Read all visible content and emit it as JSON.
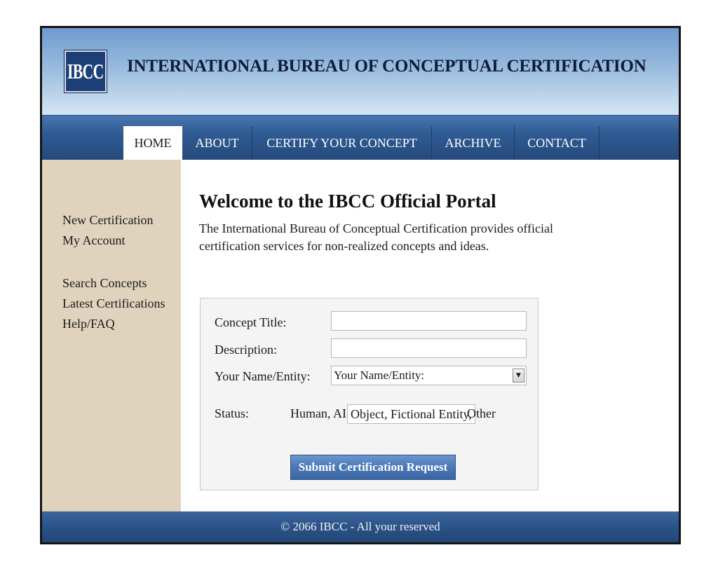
{
  "header": {
    "logo_text": "IBCC",
    "title": "INTERNATIONAL BUREAU OF CONCEPTUAL CERTIFICATION"
  },
  "nav": {
    "tabs": [
      {
        "label": "HOME",
        "active": true
      },
      {
        "label": "ABOUT",
        "active": false
      },
      {
        "label": "CERTIFY YOUR CONCEPT",
        "active": false
      },
      {
        "label": "ARCHIVE",
        "active": false
      },
      {
        "label": "CONTACT",
        "active": false
      }
    ]
  },
  "sidebar": {
    "items": [
      {
        "label": "New Certification"
      },
      {
        "label": "My Account"
      },
      {
        "label": "Search Concepts"
      },
      {
        "label": "Latest Certifications"
      },
      {
        "label": "Help/FAQ"
      }
    ]
  },
  "main": {
    "title": "Welcome to the IBCC Official Portal",
    "intro": "The International Bureau of Conceptual Certification provides official certification services for non-realized concepts and ideas."
  },
  "form": {
    "concept_title_label": "Concept Title:",
    "concept_title_value": "",
    "description_label": "Description:",
    "description_value": "",
    "name_label": "Your Name/Entity:",
    "name_selected": "Your Name/Entity:",
    "status_label": "Status:",
    "status_prefix": "Human, AI",
    "status_boxed": "Object, Fictional Entity,",
    "status_suffix": "Other",
    "submit_label": "Submit Certification Request"
  },
  "footer": {
    "text": "© 2066 IBCC - All your reserved"
  },
  "colors": {
    "nav_blue": "#2f5b93",
    "sidebar_beige": "#e0d3bd",
    "button_blue": "#4a78b6",
    "logo_navy": "#1d3f77"
  }
}
